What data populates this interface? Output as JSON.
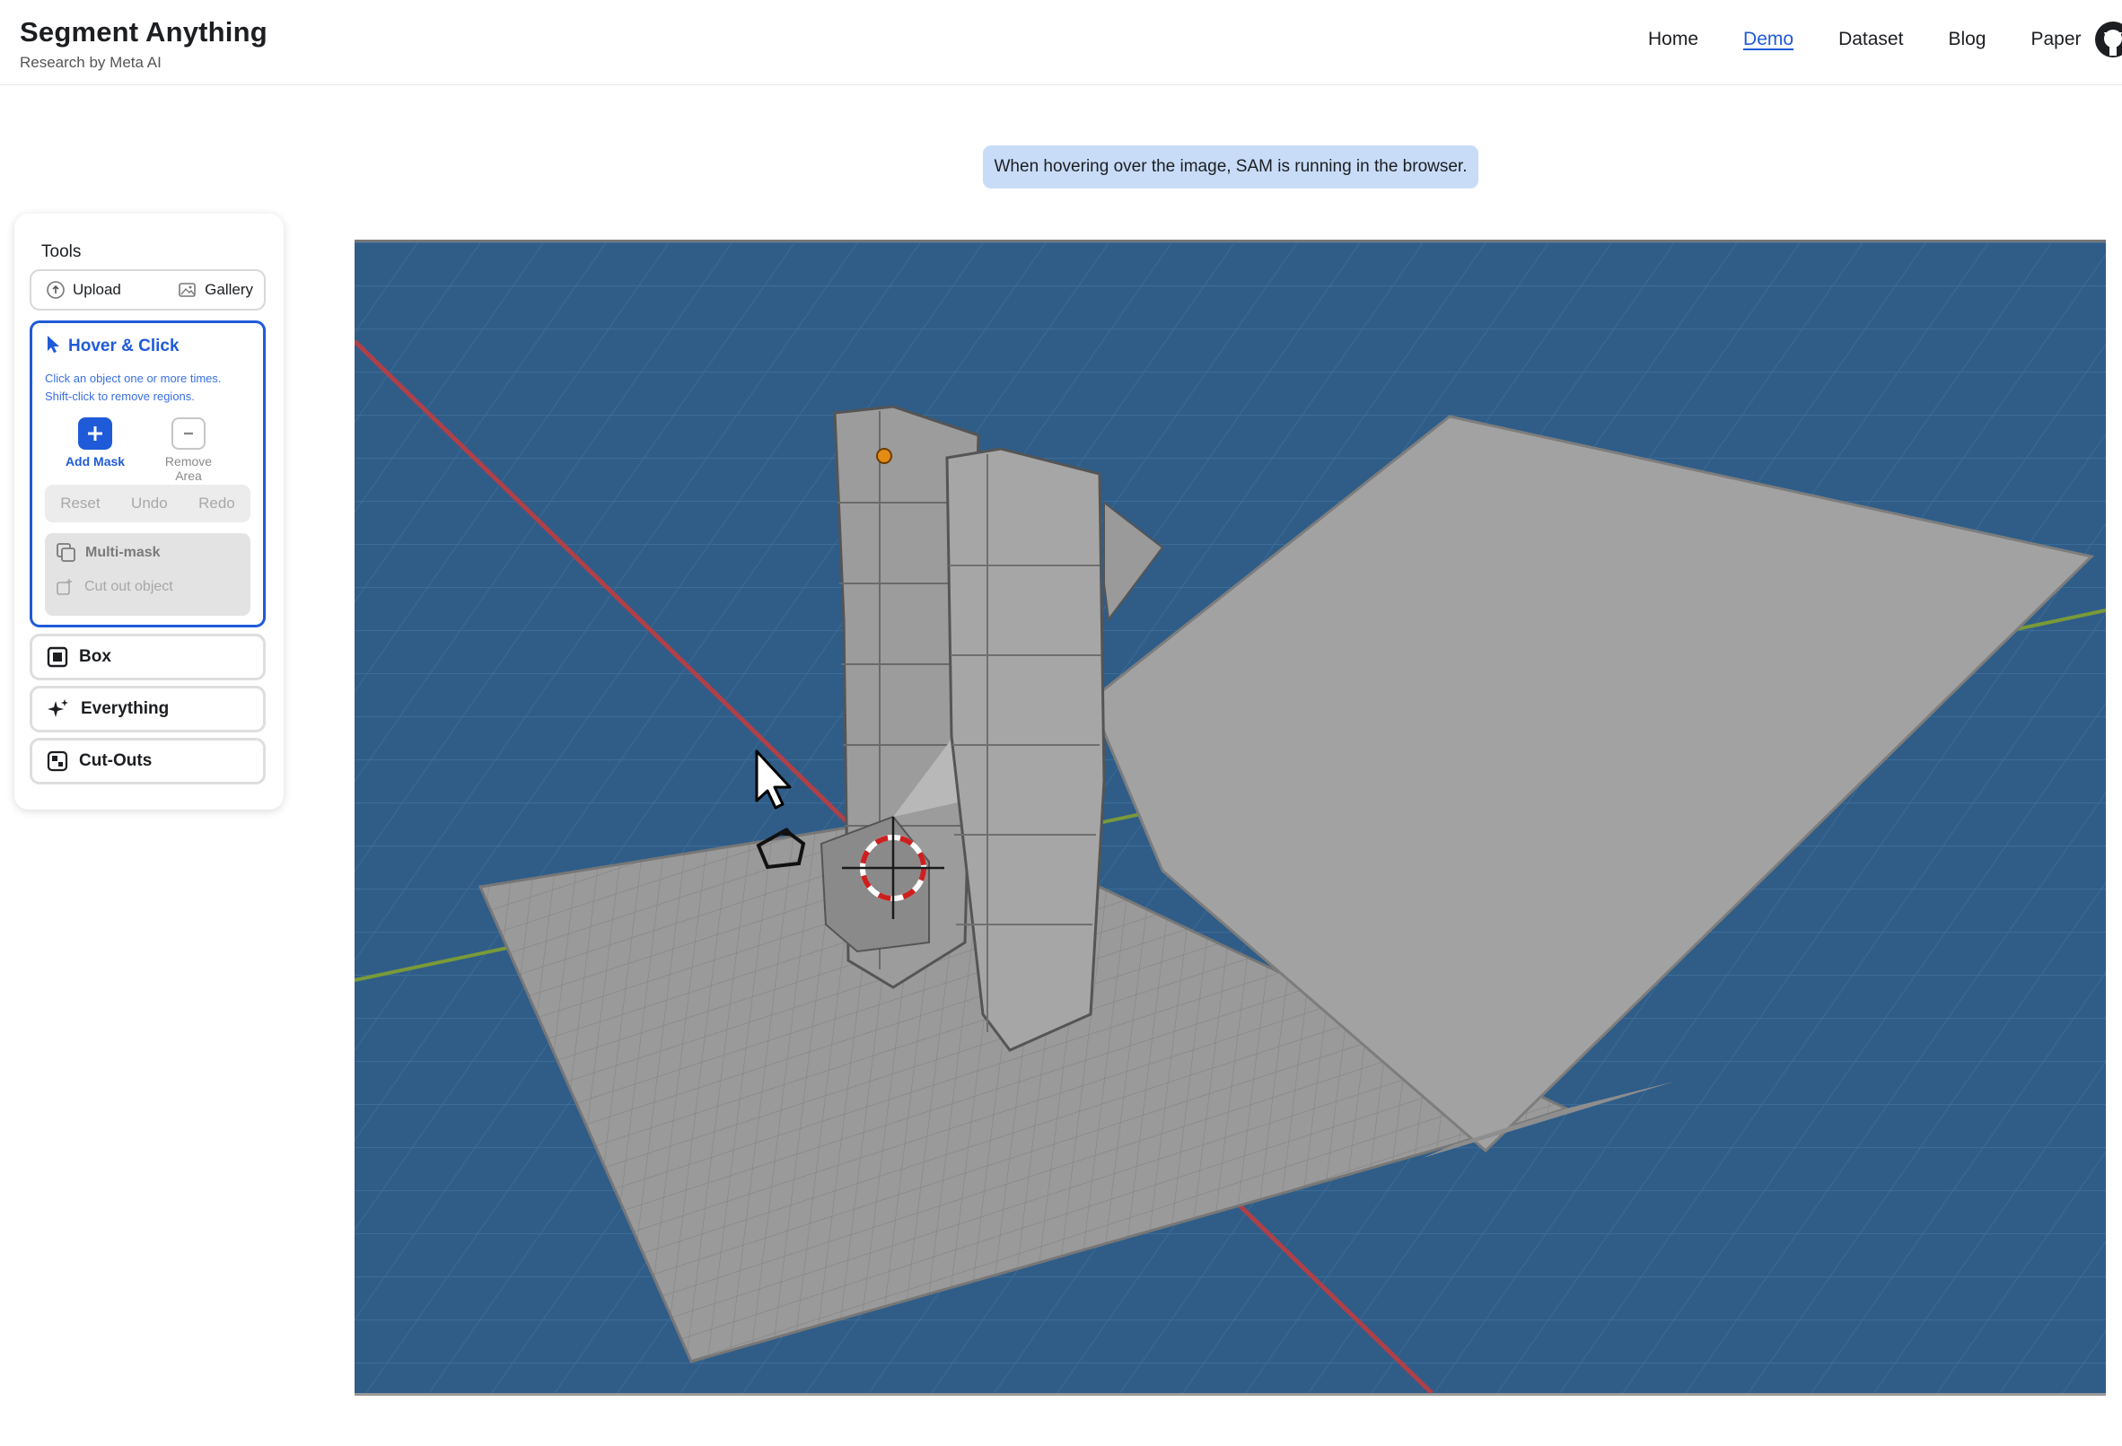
{
  "header": {
    "title": "Segment Anything",
    "subtitle": "Research by Meta AI",
    "nav": [
      {
        "label": "Home",
        "active": false
      },
      {
        "label": "Demo",
        "active": true
      },
      {
        "label": "Dataset",
        "active": false
      },
      {
        "label": "Blog",
        "active": false
      },
      {
        "label": "Paper",
        "active": false
      }
    ],
    "github_icon": "github-icon"
  },
  "hint": "When hovering over the image, SAM is running in the browser.",
  "tools": {
    "title": "Tools",
    "upload_label": "Upload",
    "gallery_label": "Gallery",
    "hover_click": {
      "title": "Hover & Click",
      "desc_line1": "Click an object one or more times.",
      "desc_line2": "Shift-click to remove regions.",
      "add_mask": "Add Mask",
      "remove_area": "Remove Area",
      "reset": "Reset",
      "undo": "Undo",
      "redo": "Redo",
      "multi_mask": "Multi-mask",
      "cut_out": "Cut out object"
    },
    "box": "Box",
    "everything": "Everything",
    "cutouts": "Cut-Outs"
  },
  "colors": {
    "accent": "#1f5bd8",
    "hint_bg": "#c8dcf8",
    "viewport_bg": "#2e5b86"
  }
}
